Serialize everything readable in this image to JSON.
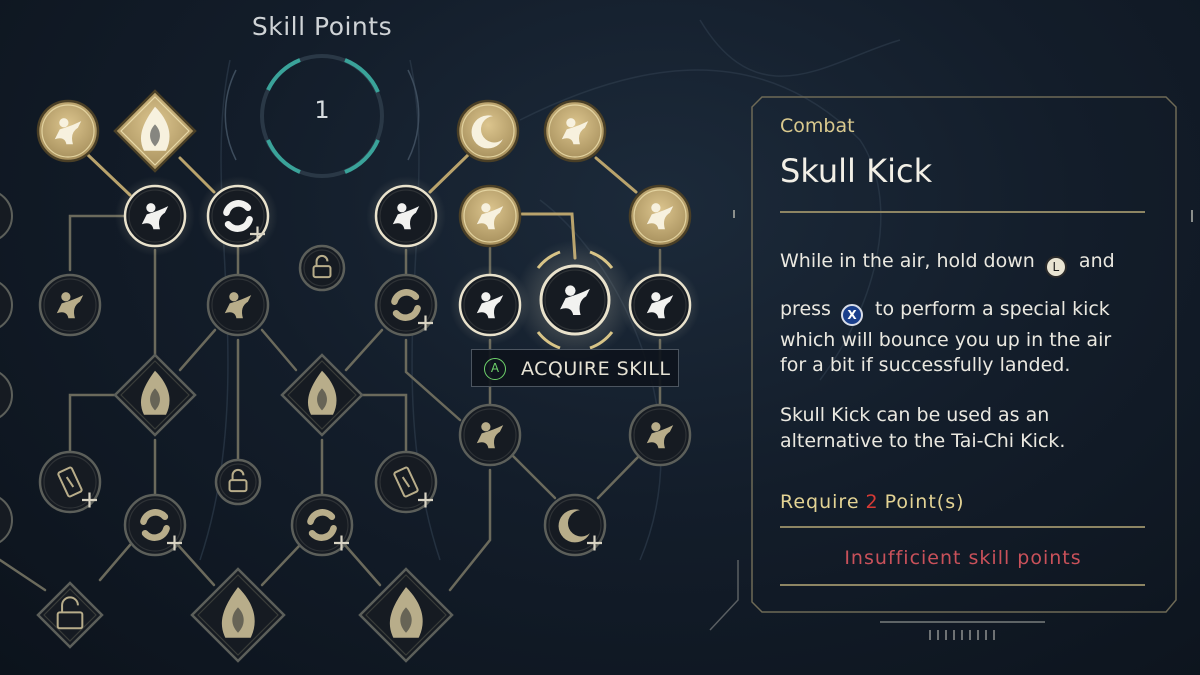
{
  "skill_points": {
    "title": "Skill Points",
    "value": "1"
  },
  "acquire": {
    "button_glyph": "A",
    "label": "ACQUIRE SKILL"
  },
  "panel": {
    "category": "Combat",
    "skill_name": "Skull Kick",
    "desc_line1_pre": "While in the air, hold down",
    "desc_line1_post": "and",
    "desc_line2_pre": "press",
    "desc_line2_post": "to perform a special kick",
    "desc_line3": "which will bounce you up in the air",
    "desc_line4": "for a bit if successfully landed.",
    "desc_line5": "Skull Kick can be used as an",
    "desc_line6": "alternative to the Tai-Chi Kick.",
    "button_l_glyph": "L",
    "button_x_glyph": "X",
    "require_pre": "Require",
    "require_points": "2",
    "require_post": "Point(s)",
    "insufficient": "Insufficient skill points"
  },
  "colors": {
    "gold": "#c8b27a",
    "node_dark": "#161b22",
    "accent_teal": "#3aa39a",
    "warning_red": "#c9515a"
  },
  "nodes": [
    {
      "id": "flame-dash",
      "icon": "flame-dash-icon",
      "shape": "circle",
      "state": "unlocked"
    },
    {
      "id": "flame-hand-core",
      "icon": "flame-hand-icon",
      "shape": "diamond",
      "state": "unlocked"
    },
    {
      "id": "crescent",
      "icon": "crescent-icon",
      "shape": "circle",
      "state": "unlocked"
    },
    {
      "id": "fist-burst",
      "icon": "fist-burst-icon",
      "shape": "circle",
      "state": "unlocked"
    },
    {
      "id": "dash-kick",
      "icon": "dash-kick-icon",
      "shape": "circle",
      "state": "available"
    },
    {
      "id": "spin-plus",
      "icon": "spin-icon",
      "shape": "circle",
      "state": "available"
    },
    {
      "id": "hat-kick",
      "icon": "hat-kick-icon",
      "shape": "circle",
      "state": "available"
    },
    {
      "id": "burst-strike",
      "icon": "burst-strike-icon",
      "shape": "circle",
      "state": "unlocked"
    },
    {
      "id": "palm-strike",
      "icon": "palm-strike-icon",
      "shape": "circle",
      "state": "unlocked"
    },
    {
      "id": "lock-a",
      "icon": "lock-icon",
      "shape": "circle",
      "state": "locked"
    },
    {
      "id": "fox",
      "icon": "fox-icon",
      "shape": "circle",
      "state": "locked"
    },
    {
      "id": "lotus",
      "icon": "lotus-icon",
      "shape": "circle",
      "state": "locked"
    },
    {
      "id": "spin-b",
      "icon": "spin-icon",
      "shape": "circle",
      "state": "locked"
    },
    {
      "id": "spark-kick",
      "icon": "spark-kick-icon",
      "shape": "circle",
      "state": "available"
    },
    {
      "id": "skull-kick",
      "icon": "skull-kick-icon",
      "shape": "circle",
      "state": "selected"
    },
    {
      "id": "wave-kick",
      "icon": "wave-kick-icon",
      "shape": "circle",
      "state": "available"
    },
    {
      "id": "flame-hand-a",
      "icon": "flame-hand-icon",
      "shape": "diamond",
      "state": "locked"
    },
    {
      "id": "flame-hand-b",
      "icon": "flame-hand-icon",
      "shape": "diamond",
      "state": "locked"
    },
    {
      "id": "bow-kick",
      "icon": "bow-kick-icon",
      "shape": "circle",
      "state": "locked"
    },
    {
      "id": "palm-strike-b",
      "icon": "palm-strike-icon",
      "shape": "circle",
      "state": "locked"
    },
    {
      "id": "scroll-a",
      "icon": "scroll-icon",
      "shape": "circle",
      "state": "locked"
    },
    {
      "id": "lock-b",
      "icon": "lock-icon",
      "shape": "circle",
      "state": "locked"
    },
    {
      "id": "scroll-b",
      "icon": "scroll-icon",
      "shape": "circle",
      "state": "locked"
    },
    {
      "id": "spin-c",
      "icon": "spin-icon",
      "shape": "circle",
      "state": "locked"
    },
    {
      "id": "spin-d",
      "icon": "spin-icon",
      "shape": "circle",
      "state": "locked"
    },
    {
      "id": "crescent-b",
      "icon": "crescent-icon",
      "shape": "circle",
      "state": "locked"
    },
    {
      "id": "lock-c",
      "icon": "lock-icon",
      "shape": "diamond",
      "state": "locked"
    },
    {
      "id": "flame-hand-c",
      "icon": "flame-hand-icon",
      "shape": "diamond",
      "state": "locked"
    },
    {
      "id": "bonfire",
      "icon": "bonfire-icon",
      "shape": "diamond",
      "state": "locked"
    }
  ]
}
